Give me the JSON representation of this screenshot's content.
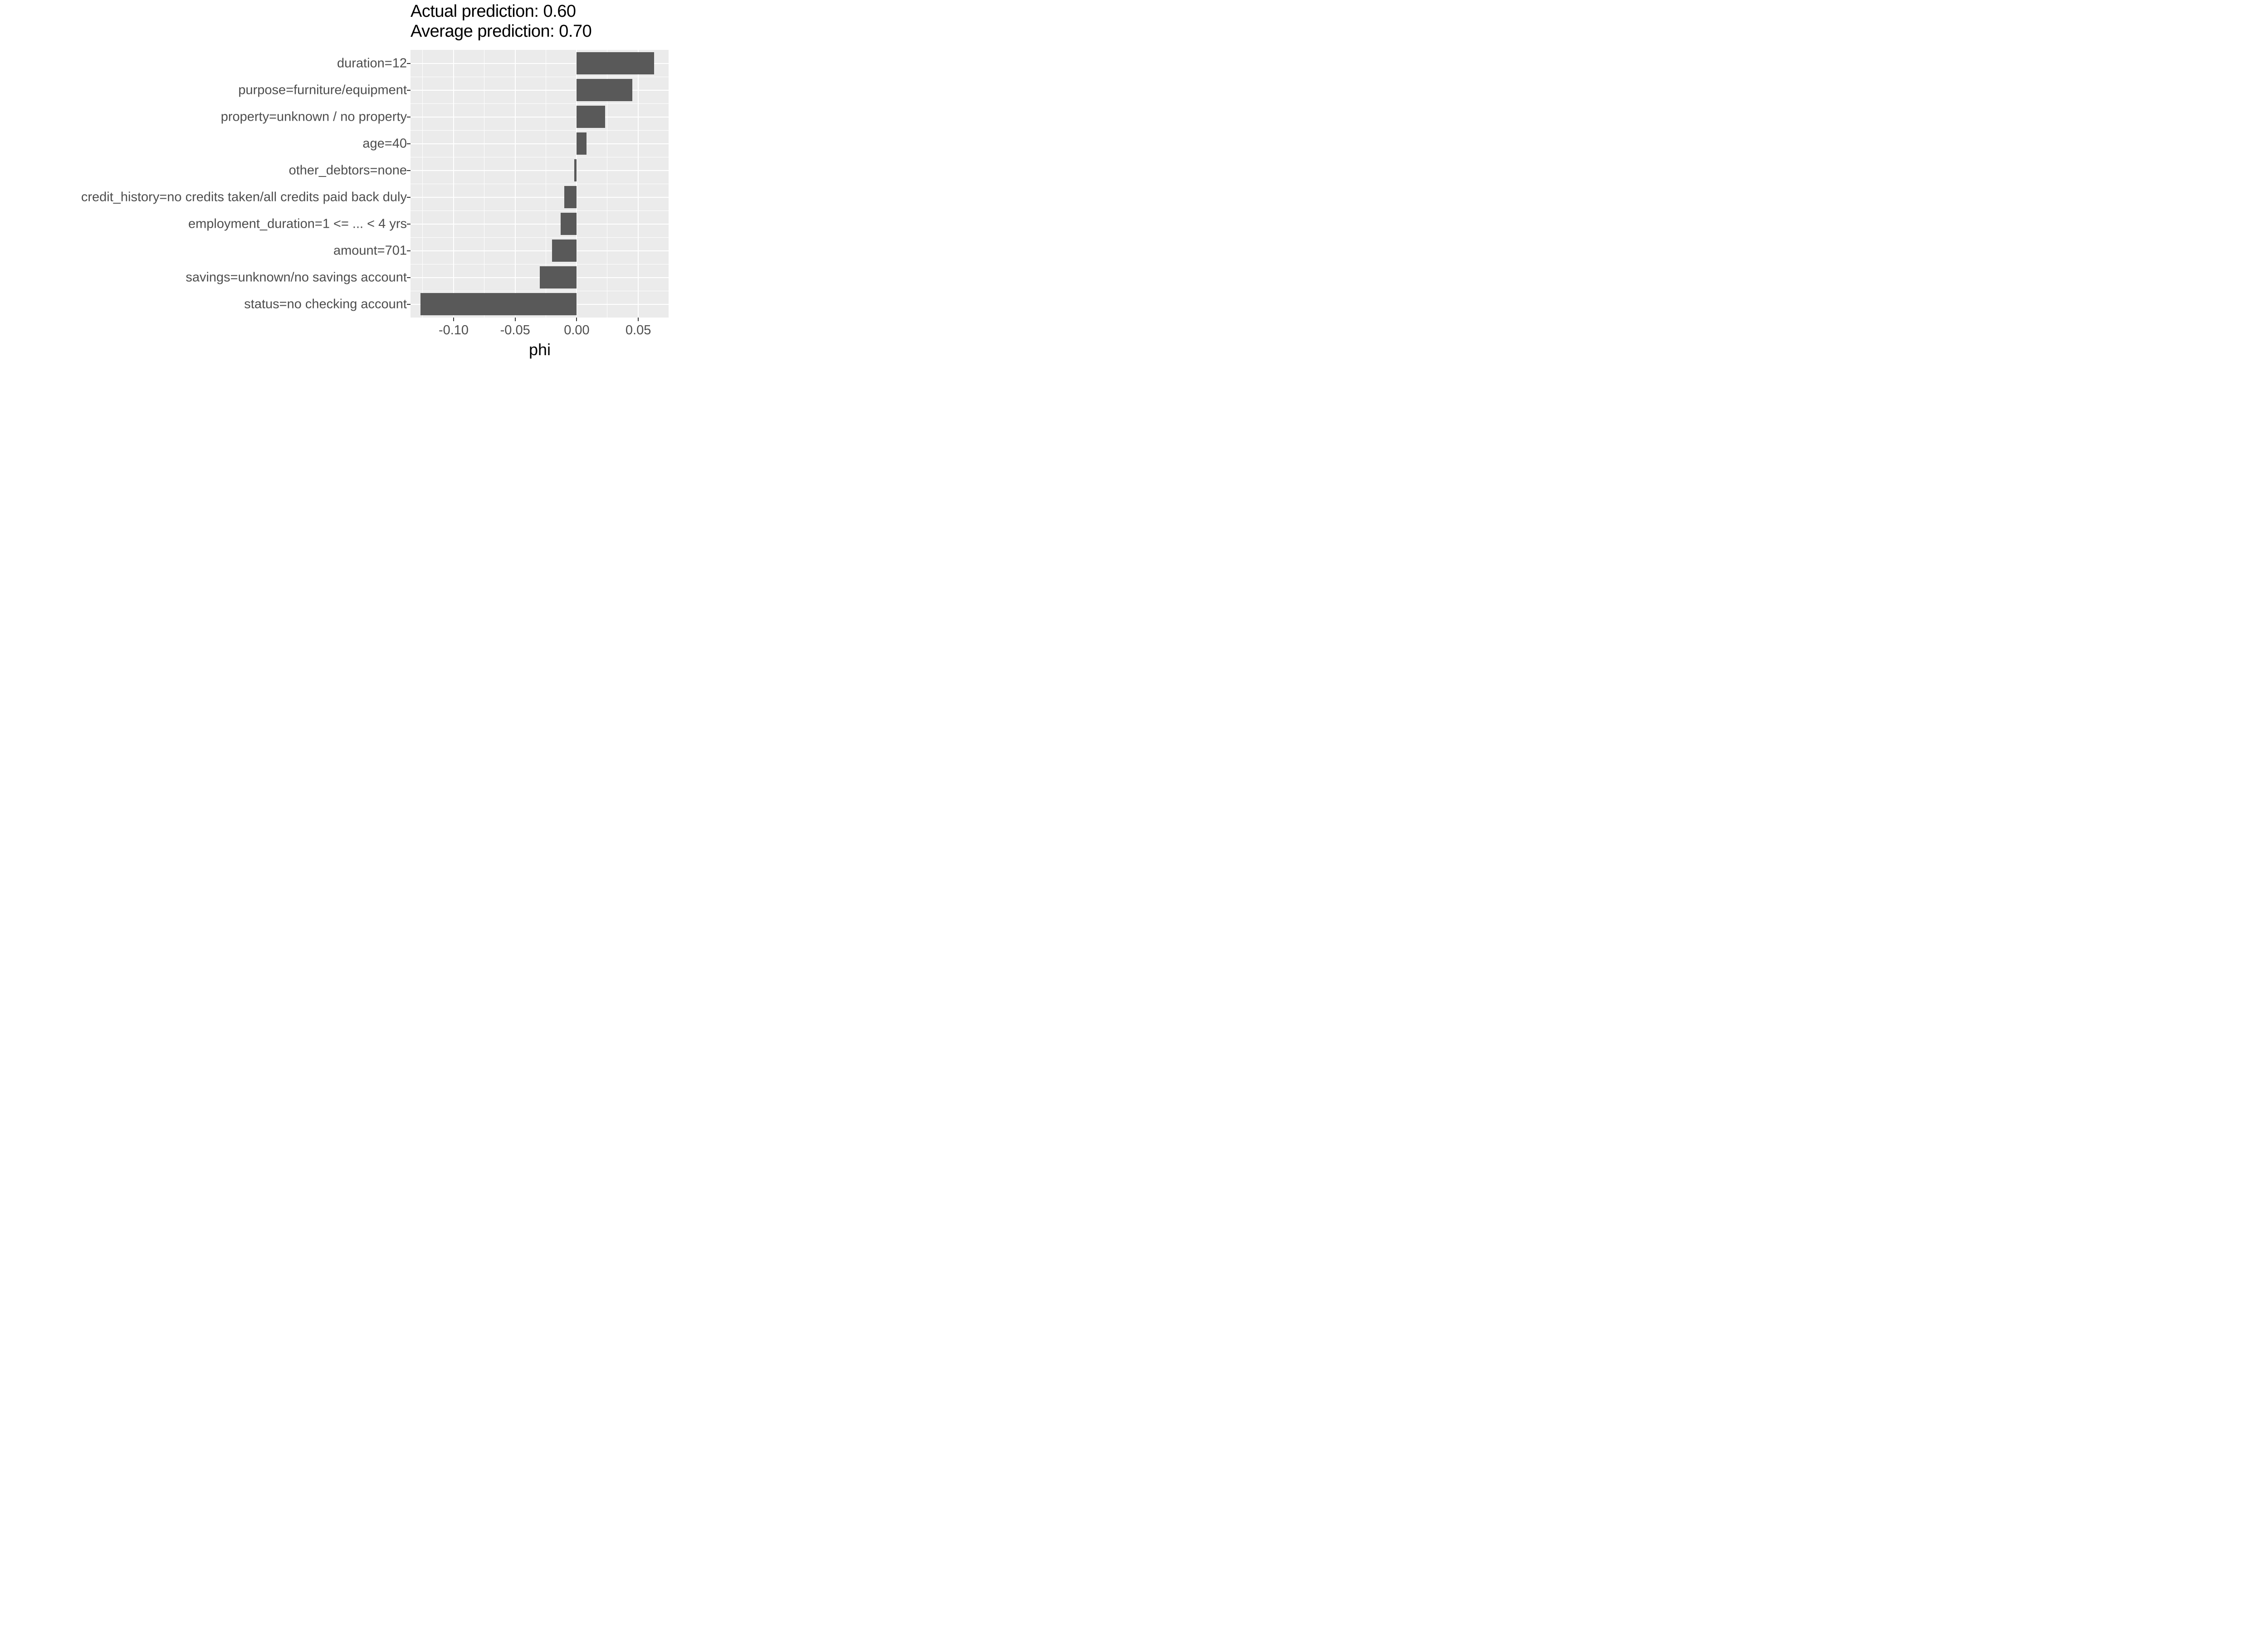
{
  "title1": "Actual prediction: 0.60",
  "title2": "Average prediction: 0.70",
  "xlabel": "phi",
  "chart_data": {
    "type": "bar",
    "orientation": "horizontal",
    "xlabel": "phi",
    "ylabel": "",
    "x_ticks": [
      -0.1,
      -0.05,
      0.0,
      0.05
    ],
    "x_tick_labels": [
      "-0.10",
      "-0.05",
      "0.00",
      "0.05"
    ],
    "xlim": [
      -0.135,
      0.075
    ],
    "categories": [
      "duration=12",
      "purpose=furniture/equipment",
      "property=unknown / no property",
      "age=40",
      "other_debtors=none",
      "credit_history=no credits taken/all credits paid back duly",
      "employment_duration=1 <= ... < 4 yrs",
      "amount=701",
      "savings=unknown/no savings account",
      "status=no checking account"
    ],
    "values": [
      0.063,
      0.045,
      0.023,
      0.008,
      -0.002,
      -0.01,
      -0.013,
      -0.02,
      -0.03,
      -0.127
    ],
    "title": "Actual prediction: 0.60\nAverage prediction: 0.70"
  }
}
